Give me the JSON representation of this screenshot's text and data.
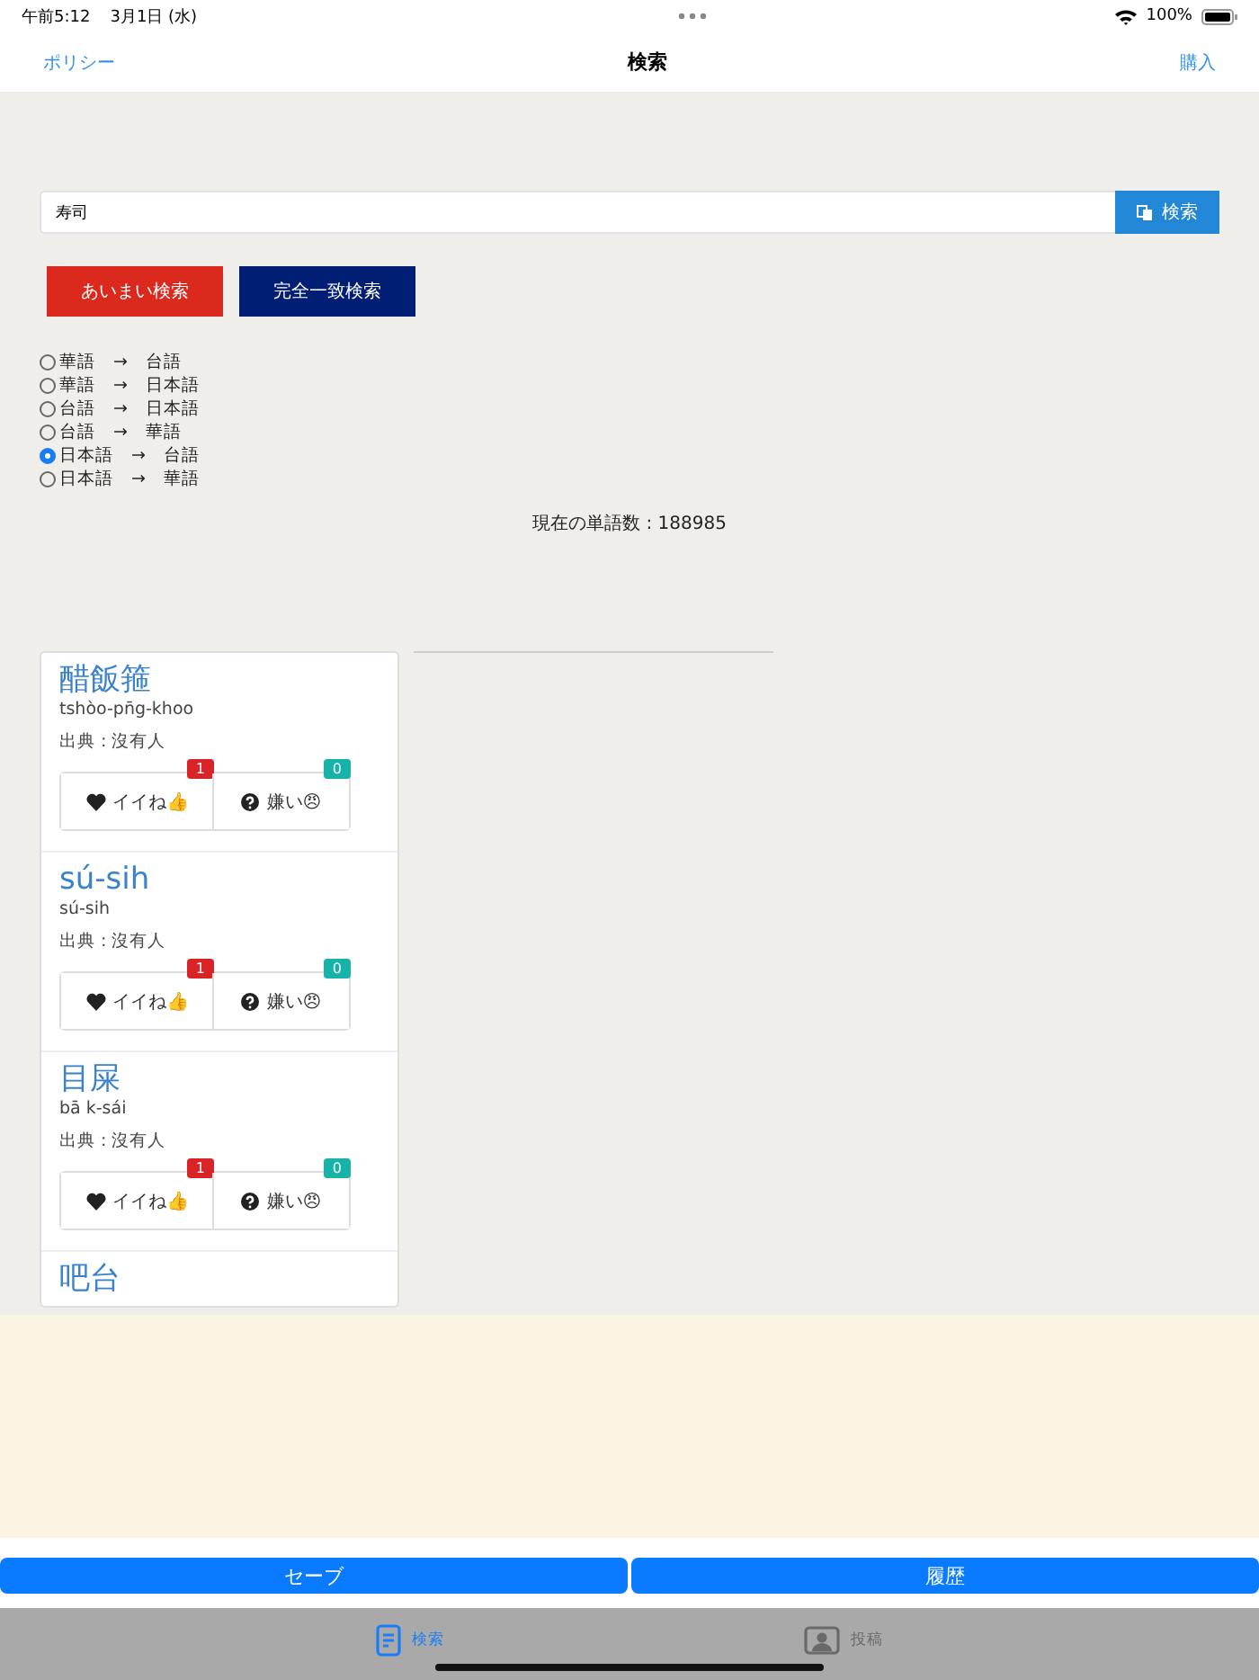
{
  "status_bar": {
    "time": "午前5:12",
    "date": "3月1日 (水)",
    "battery": "100%"
  },
  "nav": {
    "left": "ポリシー",
    "title": "検索",
    "right": "購入"
  },
  "search": {
    "value": "寿司",
    "button": "検索"
  },
  "modes": [
    {
      "label": "あいまい検索",
      "color": "#dc291e"
    },
    {
      "label": "完全一致検索",
      "color": "#001e73"
    }
  ],
  "directions": [
    {
      "from": "華語",
      "arrow": "→",
      "to": "台語",
      "selected": false
    },
    {
      "from": "華語",
      "arrow": "→",
      "to": "日本語",
      "selected": false
    },
    {
      "from": "台語",
      "arrow": "→",
      "to": "日本語",
      "selected": false
    },
    {
      "from": "台語",
      "arrow": "→",
      "to": "華語",
      "selected": false
    },
    {
      "from": "日本語",
      "arrow": "→",
      "to": "台語",
      "selected": true
    },
    {
      "from": "日本語",
      "arrow": "→",
      "to": "華語",
      "selected": false
    }
  ],
  "word_count": "現在の単語数 : 188985",
  "entries": [
    {
      "word": "醋飯箍",
      "romanization": "tshòo-pn̄g-khoo",
      "source": "出典 : 沒有人",
      "like_label": "イイね👍",
      "like_count": "1",
      "dislike_label": "嫌い😠",
      "dislike_count": "0"
    },
    {
      "word": "sú-sih",
      "romanization": "sú-sih",
      "source": "出典 : 沒有人",
      "like_label": "イイね👍",
      "like_count": "1",
      "dislike_label": "嫌い😠",
      "dislike_count": "0"
    },
    {
      "word": "目屎",
      "romanization": "bā k-sái",
      "source": "出典 : 沒有人",
      "like_label": "イイね👍",
      "like_count": "1",
      "dislike_label": "嫌い😠",
      "dislike_count": "0"
    },
    {
      "word": "吧台"
    }
  ],
  "bottom_buttons": [
    "セーブ",
    "履歴"
  ],
  "tabs": [
    {
      "label": "検索",
      "selected": true
    },
    {
      "label": "投稿",
      "selected": false
    }
  ]
}
